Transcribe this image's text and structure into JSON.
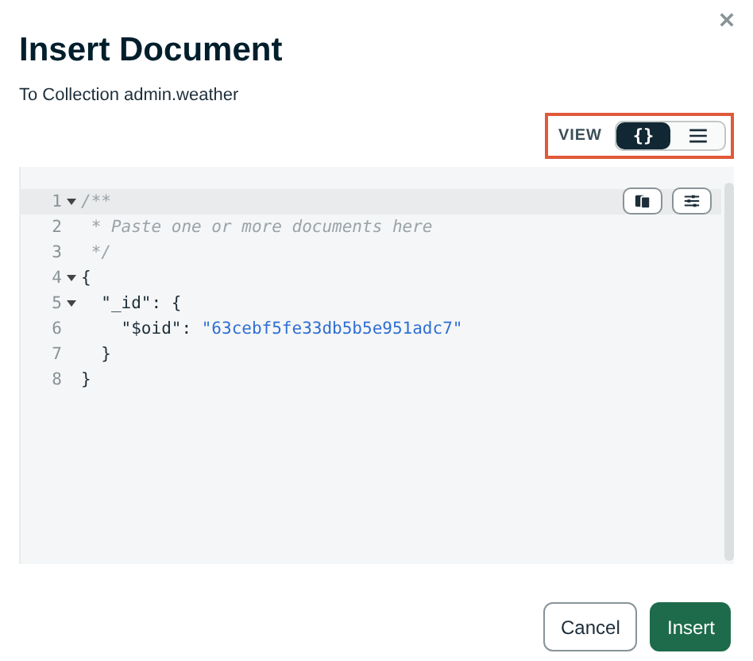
{
  "dialog": {
    "title": "Insert Document",
    "subtitle": "To Collection admin.weather"
  },
  "view_toggle": {
    "label": "VIEW",
    "options": [
      {
        "kind": "json",
        "icon_text": "{}",
        "selected": true
      },
      {
        "kind": "list",
        "selected": false
      }
    ]
  },
  "editor": {
    "lines": [
      {
        "number": "1",
        "foldable": true,
        "expanded": true,
        "active": true,
        "tokens": [
          {
            "kind": "comment",
            "text": "/**"
          }
        ]
      },
      {
        "number": "2",
        "foldable": false,
        "active": false,
        "tokens": [
          {
            "kind": "comment",
            "text": " * Paste one or more documents here"
          }
        ]
      },
      {
        "number": "3",
        "foldable": false,
        "active": false,
        "tokens": [
          {
            "kind": "comment",
            "text": " */"
          }
        ]
      },
      {
        "number": "4",
        "foldable": true,
        "expanded": true,
        "active": false,
        "tokens": [
          {
            "kind": "punct",
            "text": "{"
          }
        ]
      },
      {
        "number": "5",
        "foldable": true,
        "expanded": true,
        "active": false,
        "tokens": [
          {
            "kind": "punct",
            "text": "  \"_id\": {"
          }
        ]
      },
      {
        "number": "6",
        "foldable": false,
        "active": false,
        "tokens": [
          {
            "kind": "punct",
            "text": "    \"$oid\": "
          },
          {
            "kind": "string",
            "text": "\"63cebf5fe33db5b5e951adc7\""
          }
        ]
      },
      {
        "number": "7",
        "foldable": false,
        "active": false,
        "tokens": [
          {
            "kind": "punct",
            "text": "  }"
          }
        ]
      },
      {
        "number": "8",
        "foldable": false,
        "active": false,
        "tokens": [
          {
            "kind": "punct",
            "text": "}"
          }
        ]
      }
    ]
  },
  "buttons": [
    {
      "kind": "secondary",
      "label": "Cancel"
    },
    {
      "kind": "primary",
      "label": "Insert"
    }
  ]
}
